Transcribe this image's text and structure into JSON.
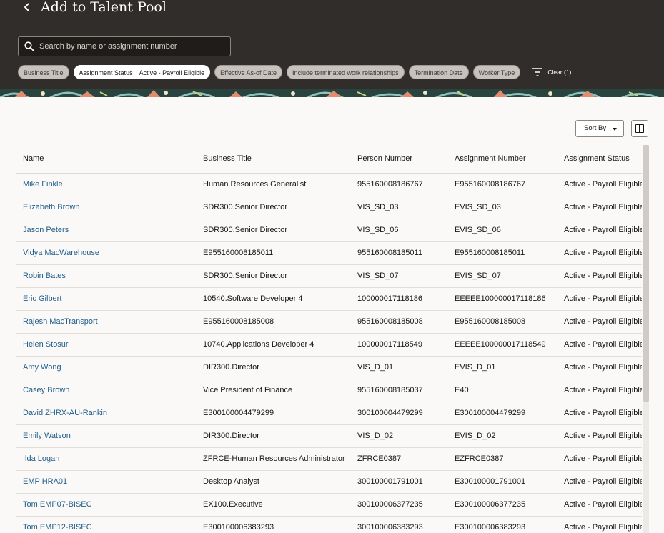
{
  "header": {
    "title": "Add to Talent Pool",
    "back_icon": "chevron-left-icon"
  },
  "search": {
    "placeholder": "Search by name or assignment number",
    "value": "",
    "icon": "search-icon"
  },
  "filters": {
    "chips": [
      {
        "label": "Business Title",
        "value": ""
      },
      {
        "label": "Assignment Status",
        "value": "Active - Payroll Eligible",
        "active": true
      },
      {
        "label": "Effective As-of Date",
        "value": ""
      },
      {
        "label": "Include terminated work relationships",
        "value": ""
      },
      {
        "label": "Termination Date",
        "value": ""
      },
      {
        "label": "Worker Type",
        "value": ""
      }
    ],
    "clear_label": "Clear (1)",
    "clear_icon": "filter-icon"
  },
  "toolbar": {
    "sort_label": "Sort By",
    "columns_icon": "columns-icon"
  },
  "table": {
    "columns": [
      "Name",
      "Business Title",
      "Person Number",
      "Assignment Number",
      "Assignment Status"
    ],
    "rows": [
      {
        "name": "Mike Finkle",
        "title": "Human Resources Generalist",
        "person": "955160008186767",
        "assignment": "E955160008186767",
        "status": "Active - Payroll Eligible"
      },
      {
        "name": "Elizabeth Brown",
        "title": "SDR300.Senior Director",
        "person": "VIS_SD_03",
        "assignment": "EVIS_SD_03",
        "status": "Active - Payroll Eligible"
      },
      {
        "name": "Jason Peters",
        "title": "SDR300.Senior Director",
        "person": "VIS_SD_06",
        "assignment": "EVIS_SD_06",
        "status": "Active - Payroll Eligible"
      },
      {
        "name": "Vidya MacWarehouse",
        "title": "E955160008185011",
        "person": "955160008185011",
        "assignment": "E955160008185011",
        "status": "Active - Payroll Eligible"
      },
      {
        "name": "Robin Bates",
        "title": "SDR300.Senior Director",
        "person": "VIS_SD_07",
        "assignment": "EVIS_SD_07",
        "status": "Active - Payroll Eligible"
      },
      {
        "name": "Eric Gilbert",
        "title": "10540.Software Developer 4",
        "person": "100000017118186",
        "assignment": "EEEEE100000017118186",
        "status": "Active - Payroll Eligible"
      },
      {
        "name": "Rajesh MacTransport",
        "title": "E955160008185008",
        "person": "955160008185008",
        "assignment": "E955160008185008",
        "status": "Active - Payroll Eligible"
      },
      {
        "name": "Helen Stosur",
        "title": "10740.Applications Developer 4",
        "person": "100000017118549",
        "assignment": "EEEEE100000017118549",
        "status": "Active - Payroll Eligible"
      },
      {
        "name": "Amy Wong",
        "title": "DIR300.Director",
        "person": "VIS_D_01",
        "assignment": "EVIS_D_01",
        "status": "Active - Payroll Eligible"
      },
      {
        "name": "Casey Brown",
        "title": "Vice President of Finance",
        "person": "955160008185037",
        "assignment": "E40",
        "status": "Active - Payroll Eligible"
      },
      {
        "name": "David ZHRX-AU-Rankin",
        "title": "E300100004479299",
        "person": "300100004479299",
        "assignment": "E300100004479299",
        "status": "Active - Payroll Eligible"
      },
      {
        "name": "Emily Watson",
        "title": "DIR300.Director",
        "person": "VIS_D_02",
        "assignment": "EVIS_D_02",
        "status": "Active - Payroll Eligible"
      },
      {
        "name": "Ilda Logan",
        "title": "ZFRCE-Human Resources Administrator",
        "person": "ZFRCE0387",
        "assignment": "EZFRCE0387",
        "status": "Active - Payroll Eligible"
      },
      {
        "name": "EMP HRA01",
        "title": "Desktop Analyst",
        "person": "300100001791001",
        "assignment": "E300100001791001",
        "status": "Active - Payroll Eligible"
      },
      {
        "name": "Tom EMP07-BISEC",
        "title": "EX100.Executive",
        "person": "300100006377235",
        "assignment": "E300100006377235",
        "status": "Active - Payroll Eligible"
      },
      {
        "name": "Tom EMP12-BISEC",
        "title": "E300100006383293",
        "person": "300100006383293",
        "assignment": "E300100006383293",
        "status": "Active - Payroll Eligible"
      }
    ]
  }
}
